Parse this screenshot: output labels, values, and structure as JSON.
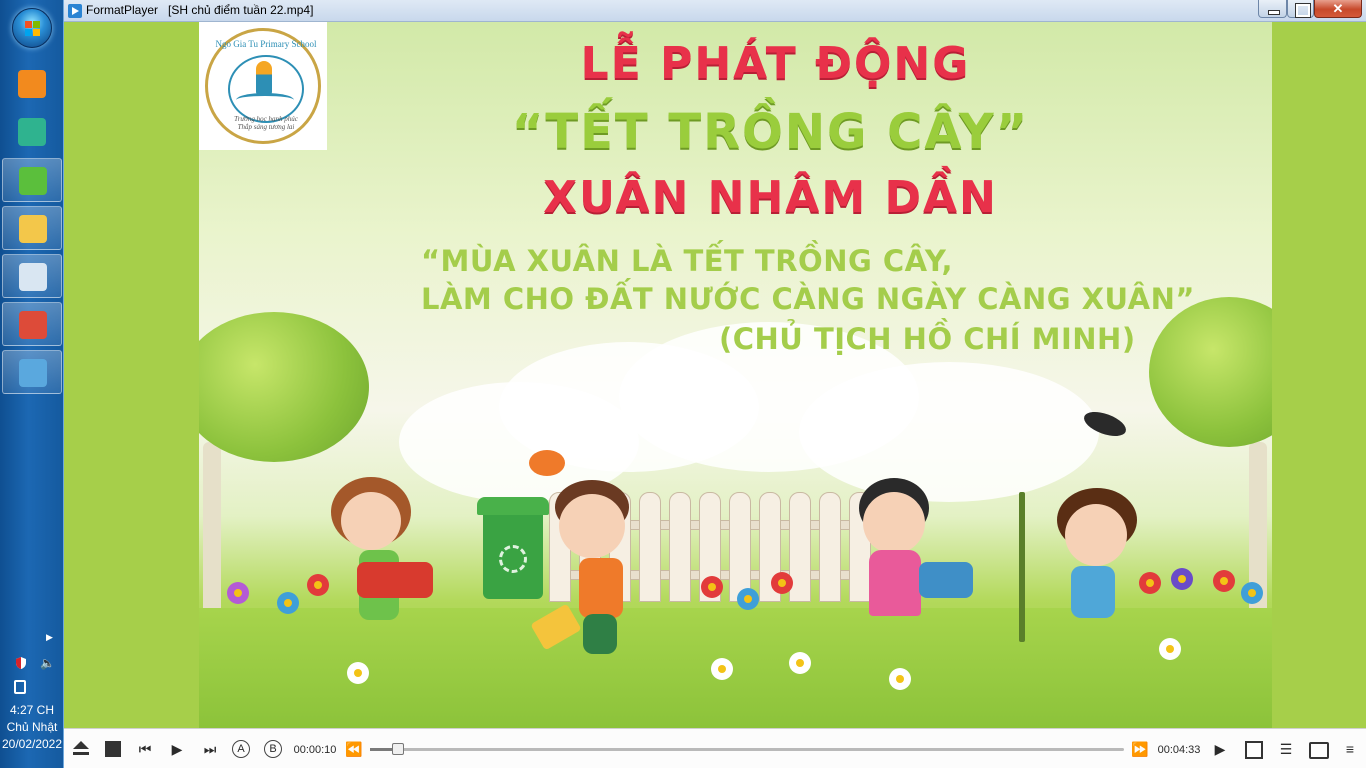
{
  "taskbar": {
    "apps": [
      {
        "name": "formatplayer",
        "color": "#f28a1e",
        "state": "pinned"
      },
      {
        "name": "network-tool",
        "color": "#2fb38f",
        "state": "pinned"
      },
      {
        "name": "browser-green",
        "color": "#5bbf3c",
        "state": "running"
      },
      {
        "name": "file-explorer",
        "color": "#f3c74a",
        "state": "running"
      },
      {
        "name": "media-capture",
        "color": "#d9e6f2",
        "state": "running"
      },
      {
        "name": "google-chrome",
        "color": "#dd4b39",
        "state": "running"
      },
      {
        "name": "video-player",
        "color": "#5aa8de",
        "state": "running"
      }
    ],
    "clock": {
      "time": "4:27 CH",
      "day": "Chủ Nhật",
      "date": "20/02/2022"
    }
  },
  "window": {
    "title": "FormatPlayer   [SH chủ điểm tuần 22.mp4]",
    "close_label": "✕"
  },
  "video": {
    "logo": {
      "school_name": "Ngo Gia Tu Primary School",
      "motto_1": "Trường học hạnh phúc",
      "motto_2": "Thắp sáng tương lai"
    },
    "title_line_1": "LỄ PHÁT ĐỘNG",
    "title_line_2": "“TẾT TRỒNG CÂY”",
    "title_line_3": "XUÂN NHÂM DẦN",
    "quote_line_1": "“MÙA XUÂN LÀ TẾT TRỒNG CÂY,",
    "quote_line_2": "LÀM CHO ĐẤT NƯỚC CÀNG NGÀY CÀNG XUÂN”",
    "quote_line_3": "(CHỦ TỊCH HỒ CHÍ MINH)"
  },
  "controls": {
    "ab_a": "A",
    "ab_b": "B",
    "time_current": "00:00:10",
    "time_total": "00:04:33",
    "progress_fraction": 0.037,
    "icons": {
      "prev": "⏮",
      "play": "▶",
      "next": "⏭",
      "rewind": "⏪",
      "forward": "⏩",
      "play_next": "▶",
      "settings": "☰",
      "playlist": "≡"
    }
  }
}
